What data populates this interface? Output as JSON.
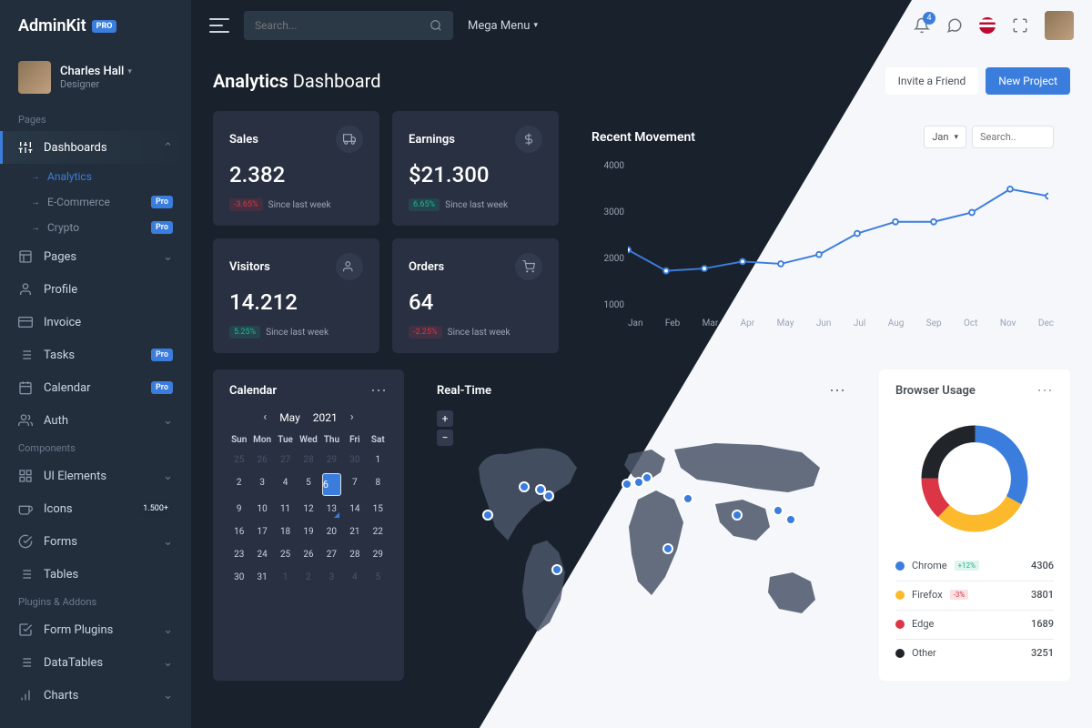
{
  "brand": {
    "name": "AdminKit",
    "badge": "PRO"
  },
  "user": {
    "name": "Charles Hall",
    "role": "Designer"
  },
  "sections": {
    "pages": "Pages",
    "components": "Components",
    "plugins": "Plugins & Addons"
  },
  "nav": {
    "dashboards": {
      "label": "Dashboards",
      "subs": {
        "analytics": "Analytics",
        "ecommerce": "E-Commerce",
        "crypto": "Crypto"
      },
      "pro": "Pro"
    },
    "pages": "Pages",
    "profile": "Profile",
    "invoice": "Invoice",
    "tasks": "Tasks",
    "calendar": "Calendar",
    "auth": "Auth",
    "ui": "UI Elements",
    "icons": "Icons",
    "iconsBadge": "1.500+",
    "forms": "Forms",
    "tables": "Tables",
    "formplugins": "Form Plugins",
    "datatables": "DataTables",
    "charts": "Charts"
  },
  "search": {
    "placeholder": "Search..."
  },
  "mega": "Mega Menu",
  "notif": "4",
  "title": {
    "a": "Analytics",
    "b": "Dashboard"
  },
  "actions": {
    "invite": "Invite a Friend",
    "newproj": "New Project"
  },
  "stats": {
    "sales": {
      "title": "Sales",
      "value": "2.382",
      "delta": "-3.65%",
      "since": "Since last week"
    },
    "earnings": {
      "title": "Earnings",
      "value": "$21.300",
      "delta": "6.65%",
      "since": "Since last week"
    },
    "visitors": {
      "title": "Visitors",
      "value": "14.212",
      "delta": "5.25%",
      "since": "Since last week"
    },
    "orders": {
      "title": "Orders",
      "value": "64",
      "delta": "-2.25%",
      "since": "Since last week"
    }
  },
  "movement": {
    "title": "Recent Movement",
    "selector": "Jan",
    "searchPlaceholder": "Search..",
    "ylabels": [
      "4000",
      "3000",
      "2000",
      "1000"
    ],
    "xlabels": [
      "Jan",
      "Feb",
      "Mar",
      "Apr",
      "May",
      "Jun",
      "Jul",
      "Aug",
      "Sep",
      "Oct",
      "Nov",
      "Dec"
    ]
  },
  "calendar": {
    "title": "Calendar",
    "month": "May",
    "year": "2021",
    "dow": [
      "Sun",
      "Mon",
      "Tue",
      "Wed",
      "Thu",
      "Fri",
      "Sat"
    ],
    "days": [
      {
        "d": "25",
        "m": 1
      },
      {
        "d": "26",
        "m": 1
      },
      {
        "d": "27",
        "m": 1
      },
      {
        "d": "28",
        "m": 1
      },
      {
        "d": "29",
        "m": 1
      },
      {
        "d": "30",
        "m": 1
      },
      {
        "d": "1"
      },
      {
        "d": "2"
      },
      {
        "d": "3"
      },
      {
        "d": "4"
      },
      {
        "d": "5"
      },
      {
        "d": "6",
        "s": 1
      },
      {
        "d": "7"
      },
      {
        "d": "8"
      },
      {
        "d": "9"
      },
      {
        "d": "10"
      },
      {
        "d": "11"
      },
      {
        "d": "12"
      },
      {
        "d": "13",
        "k": 1
      },
      {
        "d": "14"
      },
      {
        "d": "15"
      },
      {
        "d": "16"
      },
      {
        "d": "17"
      },
      {
        "d": "18"
      },
      {
        "d": "19"
      },
      {
        "d": "20"
      },
      {
        "d": "21"
      },
      {
        "d": "22"
      },
      {
        "d": "23"
      },
      {
        "d": "24"
      },
      {
        "d": "25"
      },
      {
        "d": "26"
      },
      {
        "d": "27"
      },
      {
        "d": "28"
      },
      {
        "d": "29"
      },
      {
        "d": "30"
      },
      {
        "d": "31"
      },
      {
        "d": "1",
        "m": 1
      },
      {
        "d": "2",
        "m": 1
      },
      {
        "d": "3",
        "m": 1
      },
      {
        "d": "4",
        "m": 1
      },
      {
        "d": "5",
        "m": 1
      }
    ]
  },
  "realtime": {
    "title": "Real-Time"
  },
  "browser": {
    "title": "Browser Usage",
    "items": [
      {
        "name": "Chrome",
        "delta": "+12%",
        "value": "4306",
        "color": "#3b7ddd"
      },
      {
        "name": "Firefox",
        "delta": "-3%",
        "value": "3801",
        "color": "#fcb92c"
      },
      {
        "name": "Edge",
        "value": "1689",
        "color": "#dc3545"
      },
      {
        "name": "Other",
        "value": "3251",
        "color": "#212529"
      }
    ]
  },
  "chart_data": {
    "type": "line",
    "title": "Recent Movement",
    "x": [
      "Jan",
      "Feb",
      "Mar",
      "Apr",
      "May",
      "Jun",
      "Jul",
      "Aug",
      "Sep",
      "Oct",
      "Nov",
      "Dec"
    ],
    "values": [
      2100,
      1650,
      1700,
      1850,
      1800,
      2000,
      2450,
      2700,
      2700,
      2900,
      3400,
      3250
    ],
    "ylim": [
      1000,
      4000
    ],
    "xlabel": "",
    "ylabel": ""
  }
}
